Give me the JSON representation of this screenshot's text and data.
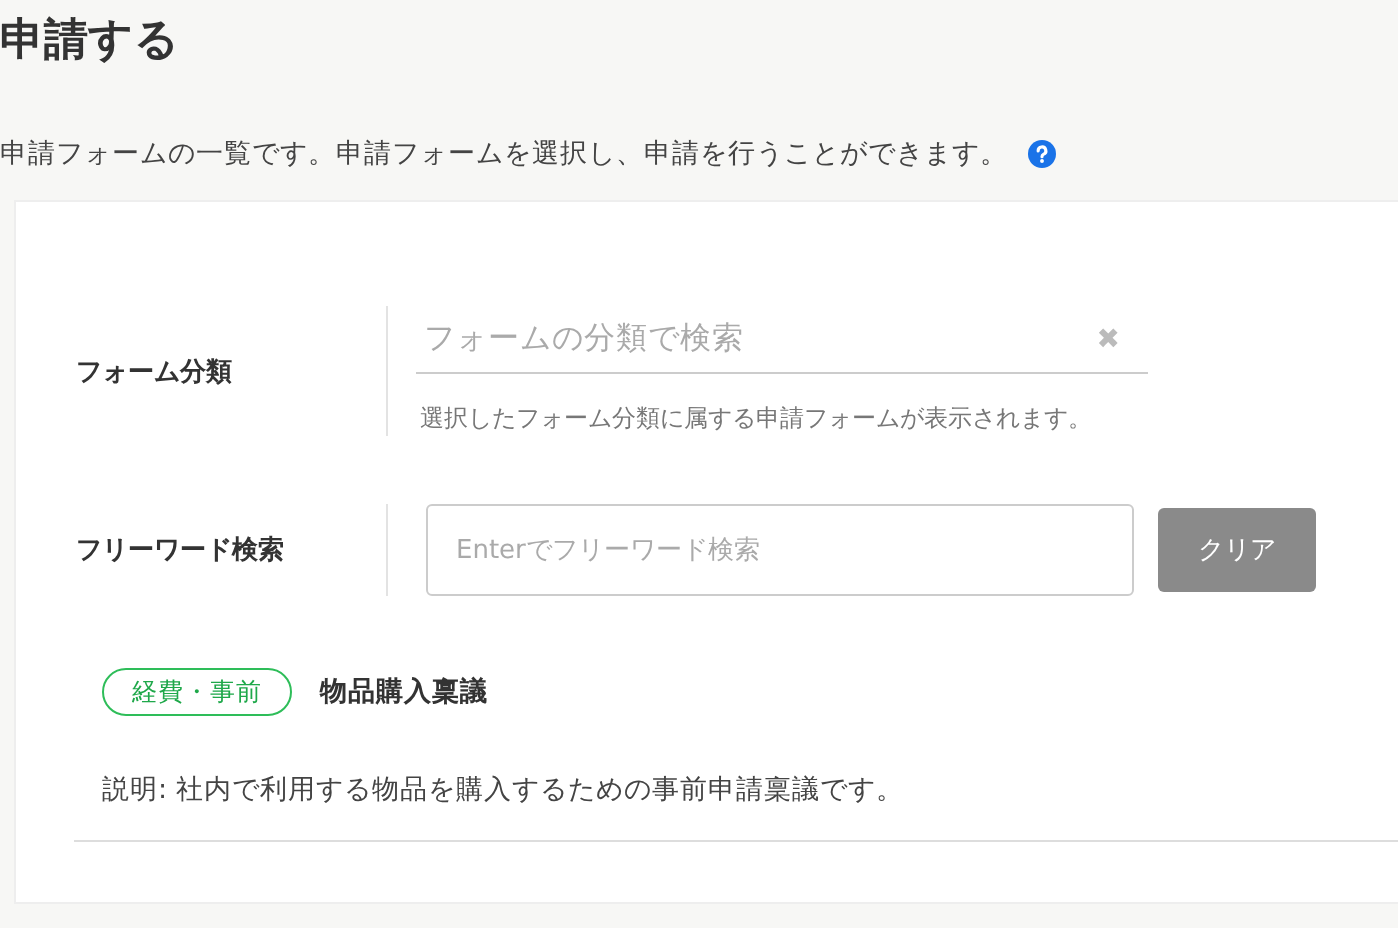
{
  "page": {
    "title": "申請する",
    "description": "申請フォームの一覧です。申請フォームを選択し、申請を行うことができます。"
  },
  "filters": [
    {
      "kind": "select",
      "label": "フォーム分類",
      "placeholder": "フォームの分類で検索",
      "clear_icon": "✖",
      "hint": "選択したフォーム分類に属する申請フォームが表示されます。"
    },
    {
      "kind": "text",
      "label": "フリーワード検索",
      "placeholder": "Enterでフリーワード検索",
      "button": "クリア"
    }
  ],
  "forms": [
    {
      "tag": "経費・事前",
      "name": "物品購入稟議",
      "description": "説明: 社内で利用する物品を購入するための事前申請稟議です。"
    }
  ]
}
